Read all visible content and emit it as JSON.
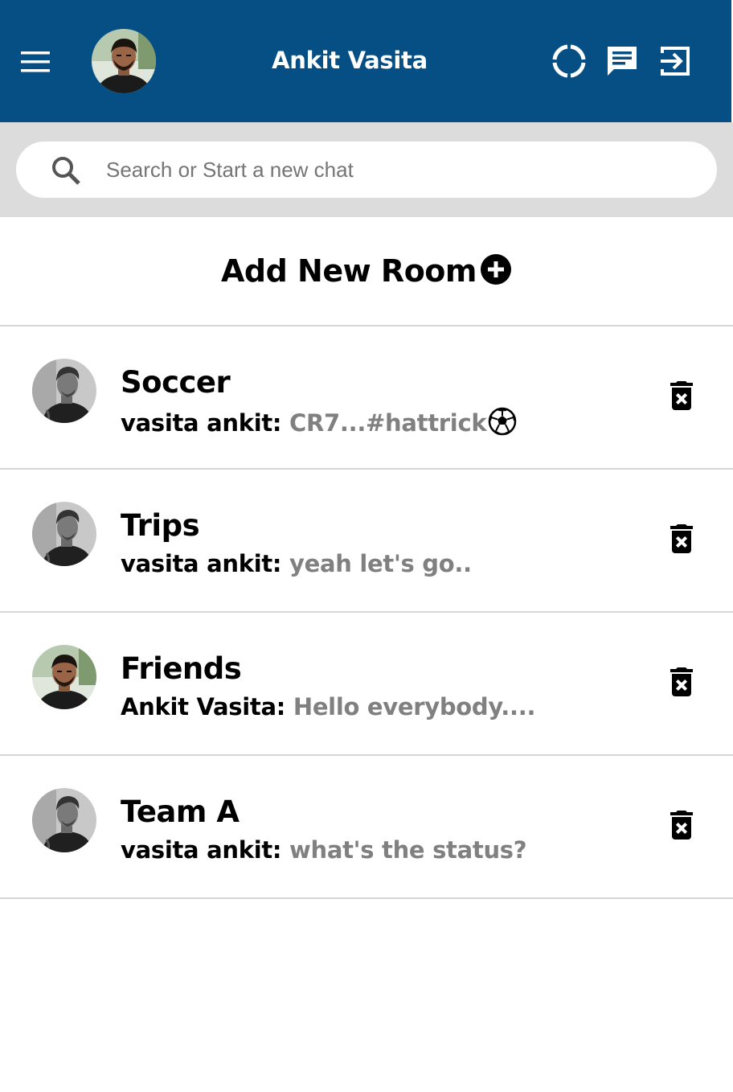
{
  "header": {
    "title": "Ankit Vasita",
    "background_color": "#064f84",
    "icons": [
      "menu-icon",
      "status-icon",
      "chat-icon",
      "logout-icon"
    ]
  },
  "search": {
    "placeholder": "Search or Start a new chat"
  },
  "add_room": {
    "label": "Add New Room"
  },
  "rooms": [
    {
      "name": "Soccer",
      "sender": "vasita ankit:",
      "message": "CR7...#hattrick",
      "message_emoji": "soccer-ball-icon",
      "avatar": "grey-portrait"
    },
    {
      "name": "Trips",
      "sender": "vasita ankit:",
      "message": "yeah let's go..",
      "avatar": "grey-portrait"
    },
    {
      "name": "Friends",
      "sender": "Ankit Vasita:",
      "message": "Hello everybody....",
      "avatar": "color-portrait"
    },
    {
      "name": "Team A",
      "sender": "vasita ankit:",
      "message": "what's the status?",
      "avatar": "grey-portrait"
    }
  ]
}
